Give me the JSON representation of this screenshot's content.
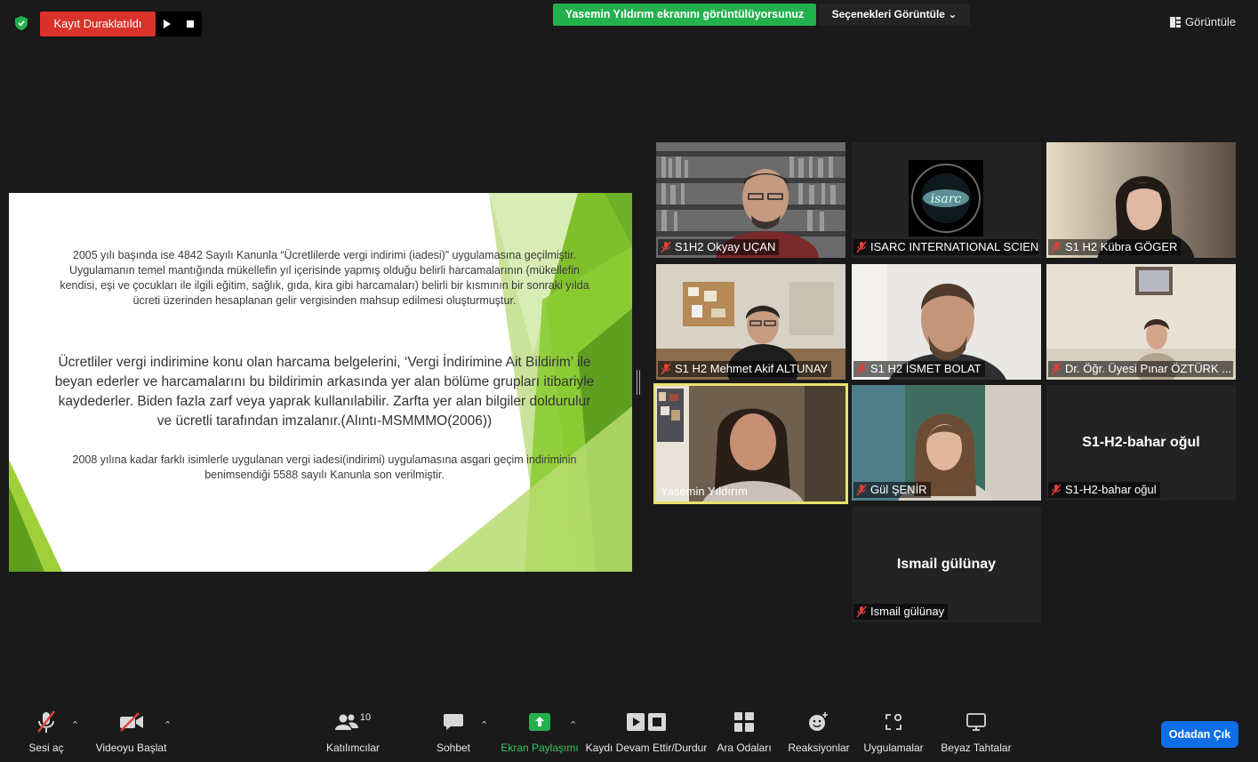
{
  "recording": {
    "status_label": "Kayıt Duraklatıldı"
  },
  "banner": {
    "text": "Yasemin Yıldırım  ekranını görüntülüyorsunuz"
  },
  "view_options": {
    "label": "Seçenekleri Görüntüle"
  },
  "view_button": {
    "label": "Görüntüle"
  },
  "slide": {
    "paragraph1": "2005 yılı başında ise 4842 Sayılı Kanunla “Ücretlilerde vergi indirimi (iadesi)” uygulamasına geçilmiştir. Uygulamanın temel mantığında mükellefin yıl içerisinde yapmış olduğu belirli harcamalarının (mükellefin kendisi, eşi ve çocukları ile ilgili eğitim, sağlık, gıda, kira gibi harcamaları) belirli bir kısmının bir sonraki yılda ücreti üzerinden hesaplanan gelir vergisinden mahsup edilmesi oluşturmuştur.",
    "paragraph2": "Ücretliler vergi indirimine konu olan harcama belgelerini, ‘Vergi İndirimine Ait Bildirim’ ile beyan ederler ve harcamalarını bu bildirimin arkasında yer alan bölüme grupları itibariyle kaydederler. Biden fazla zarf veya yaprak kullanılabilir. Zarfta yer alan bilgiler doldurulur ve ücretli tarafından imzalanır.(Alıntı-MSMMMO(2006))",
    "paragraph3": "2008 yılına kadar farklı isimlerle uygulanan vergi iadesi(indirimi) uygulamasına asgari geçim indiriminin benimsendiği 5588 sayılı Kanunla son verilmiştir."
  },
  "participants": [
    {
      "name": "S1H2 Okyay UÇAN",
      "muted": true,
      "video": true
    },
    {
      "name": "ISARC INTERNATIONAL SCIEN...",
      "muted": true,
      "video": true
    },
    {
      "name": "S1 H2 Kübra GÖGER",
      "muted": true,
      "video": true
    },
    {
      "name": "S1 H2 Mehmet Akif ALTUNAY",
      "muted": true,
      "video": true
    },
    {
      "name": "S1 H2 İSMET BOLAT",
      "muted": true,
      "video": true
    },
    {
      "name": "Dr. Öğr. Üyesi Pınar ÖZTÜRK ...",
      "muted": true,
      "video": true
    },
    {
      "name": "Yasemin Yıldırım",
      "muted": false,
      "video": true,
      "active_speaker": true
    },
    {
      "name": "Gül ŞENİR",
      "muted": true,
      "video": true
    },
    {
      "name": "S1-H2-bahar oğul",
      "muted": true,
      "video": false,
      "display_name": "S1-H2-bahar oğul"
    },
    {
      "name": "Ismail gülünay",
      "muted": true,
      "video": false,
      "display_name": "Ismail gülünay"
    }
  ],
  "toolbar": {
    "unmute": "Sesi aç",
    "start_video": "Videoyu Başlat",
    "participants": "Katılımcılar",
    "participants_count": "10",
    "chat": "Sohbet",
    "share_screen": "Ekran Paylaşımı",
    "recording": "Kaydı Devam Ettir/Durdur",
    "breakout": "Ara Odaları",
    "reactions": "Reaksiyonlar",
    "apps": "Uygulamalar",
    "whiteboards": "Beyaz Tahtalar",
    "leave": "Odadan Çık"
  },
  "colors": {
    "background": "#1a1a1a",
    "record_red": "#d9322a",
    "banner_green": "#23b14d",
    "share_green": "#23b14d",
    "leave_blue": "#0e6ee6",
    "active_speaker_outline": "#e8e26a",
    "slide_green_dark": "#5f9f1f",
    "slide_green_light": "#9fd03a",
    "muted_red": "#e0403a"
  }
}
